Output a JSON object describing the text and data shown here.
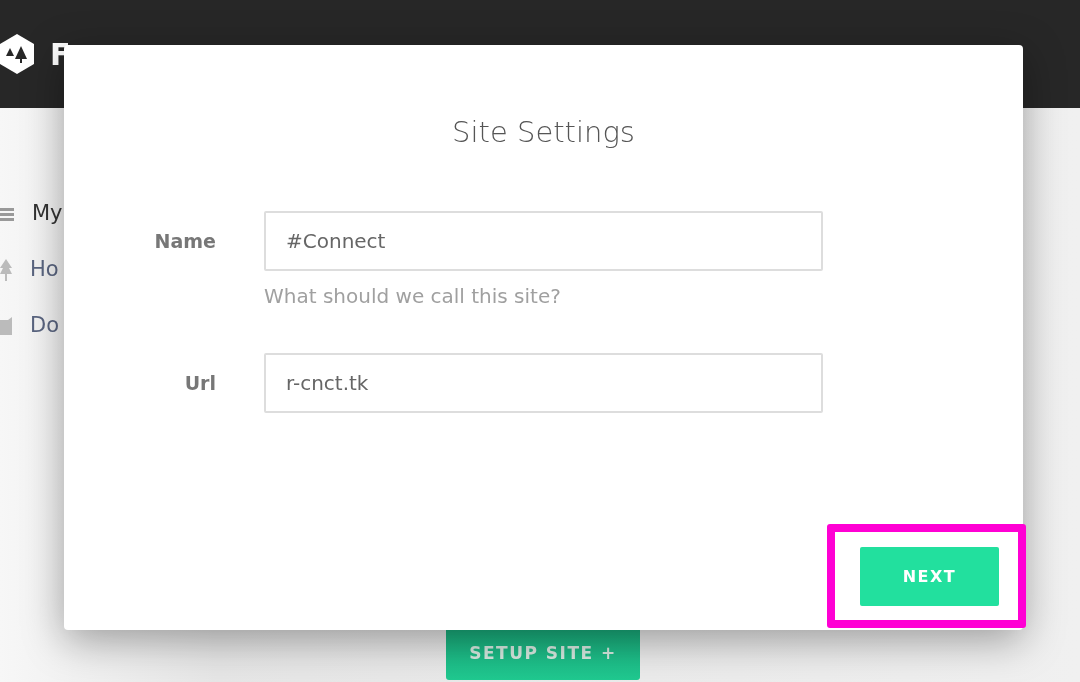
{
  "header": {
    "logo_text": "F"
  },
  "sidebar": {
    "items": [
      {
        "label": "My",
        "selected": true
      },
      {
        "label": "Ho",
        "selected": false
      },
      {
        "label": "Do",
        "selected": false
      }
    ]
  },
  "setup_button": {
    "label": "SETUP SITE",
    "icon": "+"
  },
  "modal": {
    "title": "Site Settings",
    "fields": [
      {
        "label": "Name",
        "value": "#Connect",
        "help": "What should we call this site?"
      },
      {
        "label": "Url",
        "value": "r-cnct.tk"
      }
    ],
    "next_button": {
      "label": "NEXT",
      "highlighted": true
    }
  }
}
